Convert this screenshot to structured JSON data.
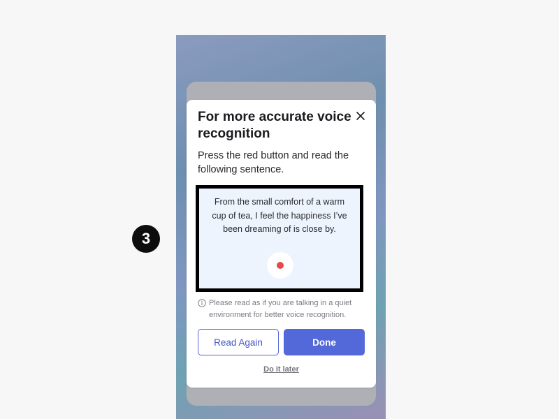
{
  "step_badge": {
    "number": "3"
  },
  "dialog": {
    "title": "For more accurate voice recognition",
    "description": "Press the red button and read the following sentence.",
    "sentence": "From the small comfort of a warm cup of tea, I feel the happiness I’ve been dreaming of is close by.",
    "info_text": "Please read as if you are talking in a quiet environment for better voice recognition.",
    "buttons": {
      "read_again": "Read Again",
      "done": "Done"
    },
    "later_link": "Do it later"
  },
  "icons": {
    "close": "close-icon",
    "record": "record-icon",
    "info": "info-icon"
  },
  "colors": {
    "accent": "#5368d9",
    "record": "#e8474b",
    "sentence_bg": "#eef4fd",
    "highlight_border": "#000000"
  }
}
